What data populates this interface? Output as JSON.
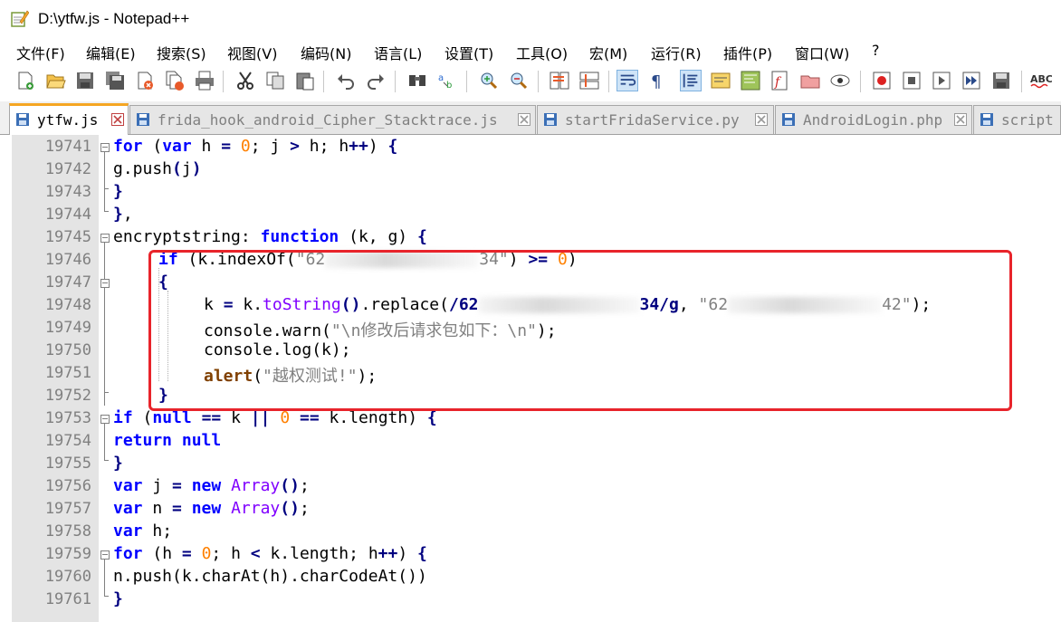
{
  "window": {
    "title": "D:\\ytfw.js - Notepad++",
    "icon": "notepad-plus-plus-icon"
  },
  "menu": [
    "文件(F)",
    "编辑(E)",
    "搜索(S)",
    "视图(V)",
    "编码(N)",
    "语言(L)",
    "设置(T)",
    "工具(O)",
    "宏(M)",
    "运行(R)",
    "插件(P)",
    "窗口(W)",
    "?"
  ],
  "toolbar": {
    "icons": [
      "new-file-icon",
      "open-file-icon",
      "save-icon",
      "save-all-icon",
      "close-icon",
      "close-all-icon",
      "print-icon",
      "cut-icon",
      "copy-icon",
      "paste-icon",
      "undo-icon",
      "redo-icon",
      "find-icon",
      "replace-icon",
      "zoom-in-icon",
      "zoom-out-icon",
      "sync-vertical-icon",
      "sync-horizontal-icon",
      "word-wrap-icon",
      "show-all-chars-icon",
      "indent-guide-icon",
      "udl-icon",
      "doc-map-icon",
      "function-list-icon",
      "folder-as-workspace-icon",
      "monitoring-icon",
      "record-macro-icon",
      "stop-record-icon",
      "play-macro-icon",
      "run-macro-multiple-icon",
      "save-macro-icon",
      "spell-check-icon"
    ]
  },
  "tabs": [
    {
      "label": "ytfw.js",
      "active": true
    },
    {
      "label": "frida_hook_android_Cipher_Stacktrace.js",
      "active": false
    },
    {
      "label": "startFridaService.py",
      "active": false
    },
    {
      "label": "AndroidLogin.php",
      "active": false
    },
    {
      "label": "script",
      "active": false
    }
  ],
  "editor": {
    "lines": [
      {
        "no": "19741"
      },
      {
        "no": "19742"
      },
      {
        "no": "19743"
      },
      {
        "no": "19744"
      },
      {
        "no": "19745"
      },
      {
        "no": "19746"
      },
      {
        "no": "19747"
      },
      {
        "no": "19748"
      },
      {
        "no": "19749"
      },
      {
        "no": "19750"
      },
      {
        "no": "19751"
      },
      {
        "no": "19752"
      },
      {
        "no": "19753"
      },
      {
        "no": "19754"
      },
      {
        "no": "19755"
      },
      {
        "no": "19756"
      },
      {
        "no": "19757"
      },
      {
        "no": "19758"
      },
      {
        "no": "19759"
      },
      {
        "no": "19760"
      },
      {
        "no": "19761"
      }
    ],
    "code": {
      "l19741": {
        "kw1": "for",
        "p1": " (",
        "kw2": "var",
        "p2": " h ",
        "op1": "=",
        "p3": " ",
        "n1": "0",
        "p4": "; j ",
        "op2": ">",
        "p5": " h; h",
        "op3": "++",
        "p6": ") ",
        "op4": "{"
      },
      "l19742": {
        "p1": "g.push",
        "op1": "(",
        "p2": "j",
        "op2": ")"
      },
      "l19743": {
        "op1": "}"
      },
      "l19744": {
        "op1": "}",
        "p1": ","
      },
      "l19745": {
        "p1": "encryptstring: ",
        "kw1": "function",
        "p2": " (k, g) ",
        "op1": "{"
      },
      "l19746": {
        "kw1": "if",
        "p1": " (k.indexOf(",
        "s1": "\"62",
        "s2": "34\"",
        "p2": ") ",
        "op1": ">=",
        "p3": " ",
        "n1": "0",
        "p4": ")"
      },
      "l19747": {
        "op1": "{"
      },
      "l19748": {
        "p1": "k ",
        "op1": "=",
        "p2": " k.",
        "f1": "toString",
        "op2": "()",
        "p3": ".replace(",
        "op3": "/62",
        "op4": "34/g",
        "p4": ", ",
        "s1": "\"62",
        "s2": "42\"",
        "p5": ");"
      },
      "l19749": {
        "p1": "console.warn(",
        "s1": "\"\\n修改后请求包如下：\\n\"",
        "p2": ");"
      },
      "l19750": {
        "p1": "console.log(k);"
      },
      "l19751": {
        "a1": "alert",
        "p1": "(",
        "s1": "\"越权测试!\"",
        "p2": ");"
      },
      "l19752": {
        "op1": "}"
      },
      "l19753": {
        "kw1": "if",
        "p1": " (",
        "kw2": "null",
        "p2": " ",
        "op1": "==",
        "p3": " k ",
        "op2": "||",
        "p4": " ",
        "n1": "0",
        "p5": " ",
        "op3": "==",
        "p6": " k.length) ",
        "op4": "{"
      },
      "l19754": {
        "kw1": "return",
        "p1": " ",
        "kw2": "null"
      },
      "l19755": {
        "op1": "}"
      },
      "l19756": {
        "kw1": "var",
        "p1": " j ",
        "op1": "=",
        "p2": " ",
        "kw2": "new",
        "p3": " ",
        "f1": "Array",
        "op2": "()",
        "p4": ";"
      },
      "l19757": {
        "kw1": "var",
        "p1": " n ",
        "op1": "=",
        "p2": " ",
        "kw2": "new",
        "p3": " ",
        "f1": "Array",
        "op2": "()",
        "p4": ";"
      },
      "l19758": {
        "kw1": "var",
        "p1": " h;"
      },
      "l19759": {
        "kw1": "for",
        "p1": " (h ",
        "op1": "=",
        "p2": " ",
        "n1": "0",
        "p3": "; h ",
        "op2": "<",
        "p4": " k.length; h",
        "op3": "++",
        "p5": ") ",
        "op4": "{"
      },
      "l19760": {
        "p1": "n.push(k.charAt(h).charCodeAt())"
      },
      "l19761": {
        "op1": "}"
      }
    }
  },
  "colors": {
    "keyword": "#0000ff",
    "number": "#ff8000",
    "string": "#808080",
    "operator": "#000080",
    "function": "#8000ff",
    "highlight_box": "#e8242b",
    "active_tab_accent": "#f5a623"
  }
}
